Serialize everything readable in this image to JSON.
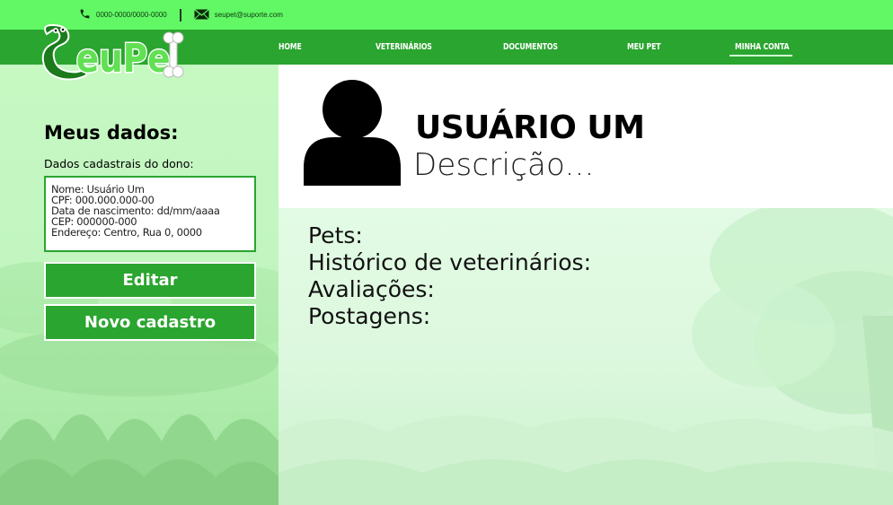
{
  "topbar": {
    "phone": "0000-0000/0000-0000",
    "phone_icon": "phone-icon",
    "email": "seupet@suporte.com",
    "email_icon": "mail-icon"
  },
  "brand": {
    "logo_text": "SeuPet",
    "logo_icon": "snake-bone-logo"
  },
  "nav": {
    "items": [
      {
        "label": "HOME"
      },
      {
        "label": "VETERINÁRIOS"
      },
      {
        "label": "DOCUMENTOS"
      },
      {
        "label": "MEU PET"
      },
      {
        "label": "MINHA CONTA",
        "active": true
      }
    ]
  },
  "sidebar": {
    "title": "Meus dados:",
    "subtitle": "Dados cadastrais do dono:",
    "info": [
      "Nome: Usuário Um",
      "CPF: 000.000.000-00",
      "Data de nascimento: dd/mm/aaaa",
      "CEP: 000000-000",
      "Endereço: Centro, Rua 0, 0000"
    ],
    "edit_label": "Editar",
    "new_label": "Novo cadastro"
  },
  "profile": {
    "avatar_icon": "user-avatar-icon",
    "name": "USUÁRIO UM",
    "description": "Descrição..."
  },
  "sections": {
    "items": [
      "Pets:",
      "Histórico de veterinários:",
      "Avaliações:",
      "Postagens:"
    ]
  },
  "colors": {
    "topbar": "#62f765",
    "navbar": "#2aa52f",
    "button": "#2aa52f",
    "sidebar_bg": "#c6f8c2",
    "main_bg": "#e3fbe5"
  }
}
